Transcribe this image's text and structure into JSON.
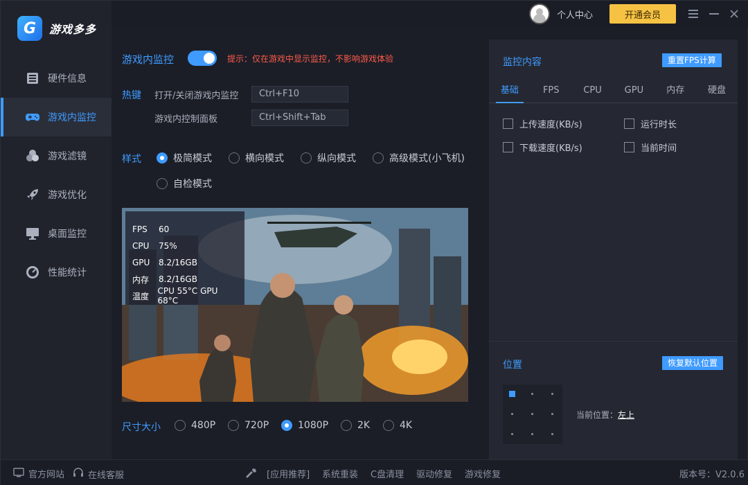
{
  "app": {
    "name": "游戏多多",
    "logo_letter": "G"
  },
  "titlebar": {
    "user_center": "个人中心",
    "vip_button": "开通会员"
  },
  "sidebar": {
    "items": [
      {
        "label": "硬件信息",
        "icon": "hardware-icon"
      },
      {
        "label": "游戏内监控",
        "icon": "gamepad-icon"
      },
      {
        "label": "游戏滤镜",
        "icon": "filter-icon"
      },
      {
        "label": "游戏优化",
        "icon": "rocket-icon"
      },
      {
        "label": "桌面监控",
        "icon": "monitor-icon"
      },
      {
        "label": "性能统计",
        "icon": "gauge-icon"
      }
    ],
    "active_index": 1
  },
  "main": {
    "monitor_label": "游戏内监控",
    "monitor_enabled": true,
    "tip": "提示：仅在游戏中显示监控，不影响游戏体验",
    "hotkey_label": "热键",
    "hotkeys": [
      {
        "name": "打开/关闭游戏内监控",
        "value": "Ctrl+F10"
      },
      {
        "name": "游戏内控制面板",
        "value": "Ctrl+Shift+Tab"
      }
    ],
    "style_label": "样式",
    "styles": [
      "极简模式",
      "横向模式",
      "纵向模式",
      "高级模式(小飞机)",
      "自检模式"
    ],
    "style_selected": "极简模式",
    "overlay": {
      "rows": [
        {
          "k": "FPS",
          "v": "60"
        },
        {
          "k": "CPU",
          "v": "75%"
        },
        {
          "k": "GPU",
          "v": "8.2/16GB"
        },
        {
          "k": "内存",
          "v": "8.2/16GB"
        },
        {
          "k": "温度",
          "v": "CPU 55°C   GPU 68°C"
        }
      ]
    },
    "size_label": "尺寸大小",
    "sizes": [
      "480P",
      "720P",
      "1080P",
      "2K",
      "4K"
    ],
    "size_selected": "1080P"
  },
  "right": {
    "content_title": "监控内容",
    "reset_fps_button": "重置FPS计算",
    "tabs": [
      "基础",
      "FPS",
      "CPU",
      "GPU",
      "内存",
      "硬盘"
    ],
    "active_tab": "基础",
    "checks": [
      {
        "label": "上传速度(KB/s)",
        "checked": false
      },
      {
        "label": "运行时长",
        "checked": false
      },
      {
        "label": "下载速度(KB/s)",
        "checked": false
      },
      {
        "label": "当前时间",
        "checked": false
      }
    ],
    "position_title": "位置",
    "reset_position_button": "恢复默认位置",
    "current_position_label": "当前位置：",
    "current_position_value": "左上"
  },
  "footer": {
    "official_site": "官方网站",
    "online_service": "在线客服",
    "links": [
      "[应用推荐]",
      "系统重装",
      "C盘清理",
      "驱动修复",
      "游戏修复"
    ],
    "version": "版本号：V2.0.6"
  },
  "colors": {
    "accent": "#3f9bff",
    "warning": "#ff5a4a",
    "vip": "#f6c244"
  }
}
